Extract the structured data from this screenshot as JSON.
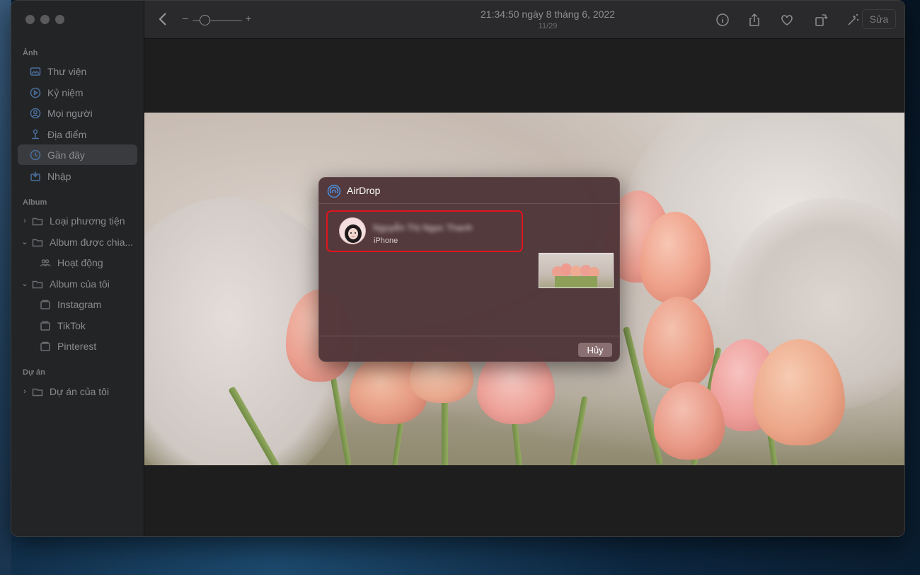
{
  "sidebar": {
    "sections": [
      {
        "title": "Ảnh"
      },
      {
        "title": "Album"
      },
      {
        "title": "Dự án"
      }
    ],
    "items": [
      {
        "label": "Thư viện",
        "icon": "photos-library-icon"
      },
      {
        "label": "Kỷ niệm",
        "icon": "memories-icon"
      },
      {
        "label": "Mọi người",
        "icon": "people-icon"
      },
      {
        "label": "Địa điểm",
        "icon": "places-pin-icon"
      },
      {
        "label": "Gần đây",
        "icon": "recents-clock-icon",
        "selected": true
      },
      {
        "label": "Nhập",
        "icon": "import-icon"
      },
      {
        "label": "Loại phương tiện",
        "icon": "folder-icon"
      },
      {
        "label": "Album được chia...",
        "icon": "shared-album-icon"
      },
      {
        "label": "Hoạt động",
        "icon": "activity-people-icon"
      },
      {
        "label": "Album của tôi",
        "icon": "folder-icon"
      },
      {
        "label": "Instagram",
        "icon": "album-icon"
      },
      {
        "label": "TikTok",
        "icon": "album-icon"
      },
      {
        "label": "Pinterest",
        "icon": "album-icon"
      },
      {
        "label": "Dự án của tôi",
        "icon": "folder-icon"
      }
    ]
  },
  "toolbar": {
    "zoom_minus": "–",
    "zoom_plus": "+",
    "zoom_level": 0.25,
    "title": "21:34:50 ngày 8 tháng 6, 2022",
    "subtitle": "11/29",
    "edit_label": "Sửa"
  },
  "airdrop": {
    "title": "AirDrop",
    "device_name": "Nguyễn Thị Ngọc Thanh",
    "device_type": "iPhone",
    "cancel_label": "Hủy"
  },
  "colors": {
    "accent": "#4b6f9c",
    "highlight_border": "#e0141e",
    "dialog_bg": "#4e3437"
  }
}
